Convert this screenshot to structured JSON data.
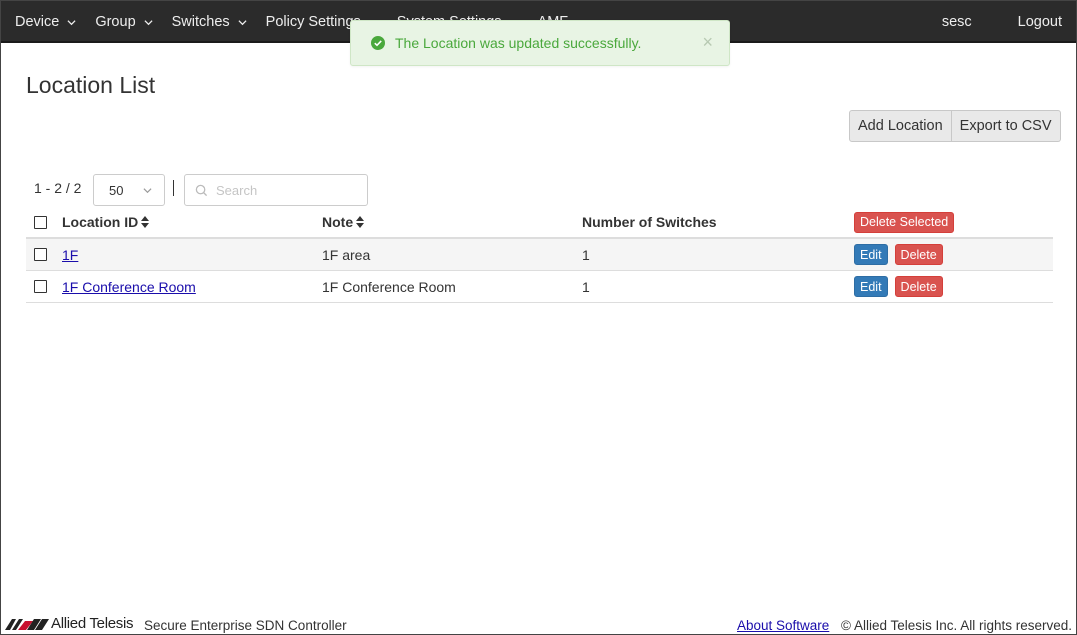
{
  "nav": {
    "items": [
      {
        "label": "Device"
      },
      {
        "label": "Group"
      },
      {
        "label": "Switches"
      },
      {
        "label": "Policy Settings"
      },
      {
        "label": "System Settings"
      },
      {
        "label": "AMF"
      }
    ],
    "user": "sesc",
    "logout": "Logout"
  },
  "toast": {
    "message": "The Location was updated successfully.",
    "close": "×",
    "color": "#4aa83c"
  },
  "page": {
    "title": "Location List"
  },
  "toolbar": {
    "add_label": "Add Location",
    "export_label": "Export to CSV"
  },
  "pager": {
    "range": "1 - 2 / 2",
    "per_page": "50"
  },
  "search": {
    "placeholder": "Search"
  },
  "table": {
    "columns": {
      "id": "Location ID",
      "note": "Note",
      "count": "Number of Switches"
    },
    "delete_selected": "Delete Selected",
    "rows": [
      {
        "id": "1F",
        "note": "1F area",
        "count": "1",
        "edit": "Edit",
        "delete": "Delete"
      },
      {
        "id": "1F Conference Room",
        "note": "1F Conference Room",
        "count": "1",
        "edit": "Edit",
        "delete": "Delete"
      }
    ]
  },
  "footer": {
    "brand": "Allied Telesis",
    "product": "Secure Enterprise SDN Controller",
    "about": "About Software",
    "copyright": "© Allied Telesis Inc. All rights reserved."
  }
}
